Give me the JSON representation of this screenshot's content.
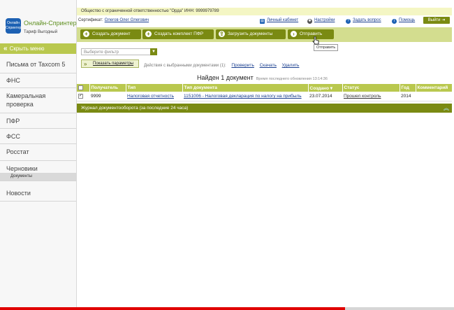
{
  "sidebar": {
    "logo_mark": "Онлайн Спринтер",
    "app_name": "Онлайн-Спринтер",
    "tariff": "Тариф Выгодный",
    "collapse_label": "Скрыть меню",
    "items": [
      {
        "label": "Письма от Taxcom 5"
      },
      {
        "label": "ФНС"
      },
      {
        "label": "Камеральная проверка"
      },
      {
        "label": "ПФР"
      },
      {
        "label": "ФСС"
      },
      {
        "label": "Росстат"
      },
      {
        "label": "Черновики"
      },
      {
        "label": "Новости"
      }
    ],
    "sub_item": "Документы"
  },
  "header": {
    "org": "Общество с ограниченной ответственностью \"Орда\" ИНН: 9999979789",
    "cert_label": "Сертификат:",
    "cert_name": "Олегов Олег Олегович",
    "links": {
      "cabinet": "Личный кабинет",
      "settings": "Настройки",
      "ask": "Задать вопрос",
      "help": "Помощь"
    },
    "logout": "Выйти"
  },
  "toolbar": {
    "create_doc": "Создать документ",
    "create_pfr": "Создать комплект ПФР",
    "upload": "Загрузить документы",
    "send": "Отправить",
    "tooltip": "Отправить"
  },
  "filter": {
    "placeholder": "Выберите фильтр",
    "params_button": "Показать параметры",
    "actions_label": "Действия с выбранными документами (1):",
    "check": "Проверить",
    "download": "Скачать",
    "delete": "Удалить"
  },
  "found": {
    "text": "Найден 1 документ",
    "updated": "Время последнего обновления 13:14:36"
  },
  "table": {
    "headers": [
      "Получатель",
      "Тип",
      "Тип документа",
      "Создано ▾",
      "Статус",
      "Год",
      "Комментарий"
    ],
    "rows": [
      {
        "checked": "✓",
        "recipient": "9999",
        "type": "Налоговая отчетность",
        "doc_type": "1151006 - Налоговая декларация по налогу на прибыль",
        "created": "23.07.2014",
        "status": "Прошел контроль",
        "year": "2014",
        "comment": ""
      }
    ]
  },
  "journal": {
    "label": "Журнал документооборота (за последние 24 часа)"
  },
  "progress": {
    "fraction": 0.76
  }
}
